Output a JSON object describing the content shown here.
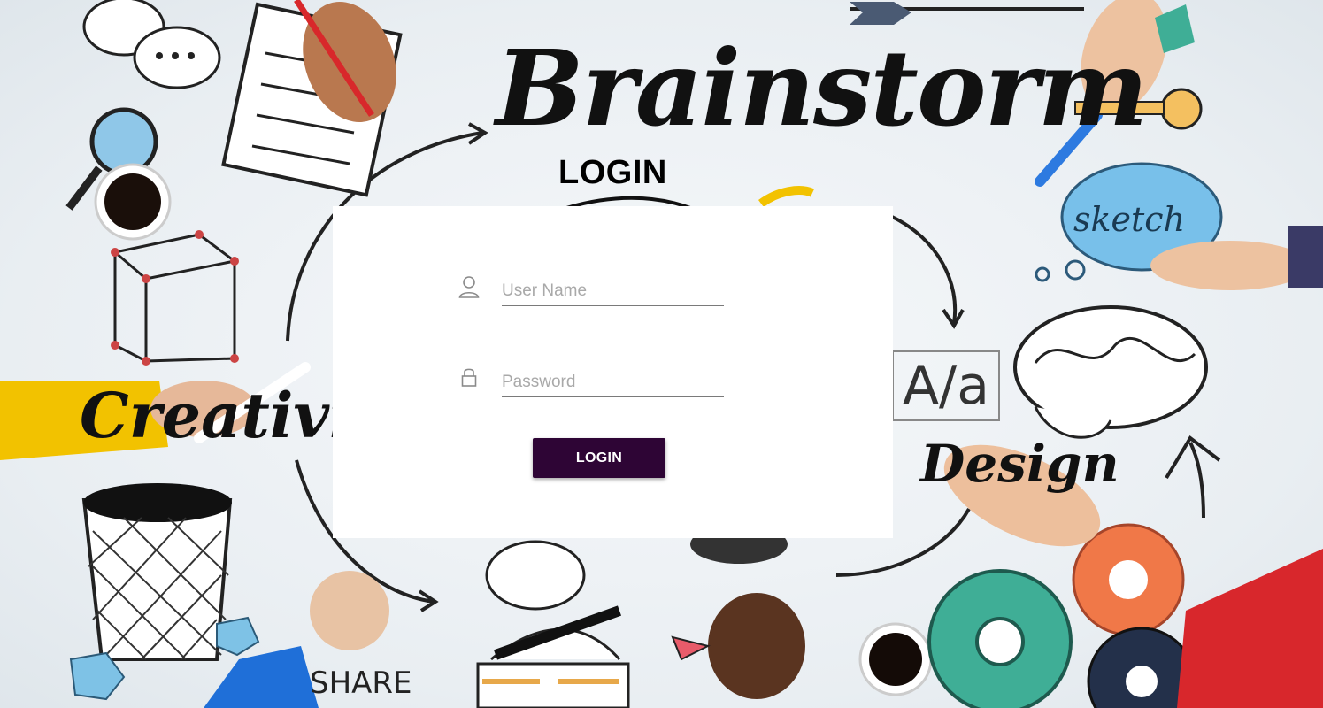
{
  "background": {
    "brand_text": "Brainstorm",
    "creativity_text": "Creativity",
    "design_text": "Design",
    "sketch_text": "sketch",
    "aa_text": "A/a",
    "share_text": "SHARE"
  },
  "login": {
    "title": "LOGIN",
    "username_placeholder": "User Name",
    "username_value": "",
    "password_placeholder": "Password",
    "password_value": "",
    "submit_label": "LOGIN"
  },
  "icons": {
    "username_icon": "person-icon",
    "password_icon": "lock-icon"
  },
  "colors": {
    "button_bg": "#2e0535",
    "button_text": "#ffffff",
    "card_bg": "#ffffff"
  }
}
